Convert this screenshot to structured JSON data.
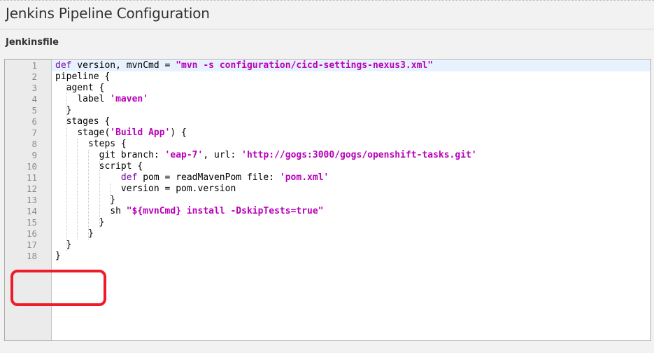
{
  "page": {
    "title": "Jenkins Pipeline Configuration",
    "section_label": "Jenkinsfile"
  },
  "editor": {
    "language": "groovy",
    "active_line": 1,
    "highlighted_lines": [
      17,
      18
    ],
    "highlight_color": "#ee1c2a",
    "keyword_color": "#7a0aa8",
    "string_color": "#b800b8",
    "lines": [
      {
        "n": "1",
        "indent": 0,
        "tokens": [
          {
            "t": "def",
            "k": "kw"
          },
          {
            "t": " version, mvnCmd = "
          },
          {
            "t": "\"mvn -s configuration/cicd-settings-nexus3.xml\"",
            "k": "str"
          }
        ]
      },
      {
        "n": "2",
        "indent": 0,
        "tokens": [
          {
            "t": "pipeline {"
          }
        ]
      },
      {
        "n": "3",
        "indent": 2,
        "tokens": [
          {
            "t": "agent {"
          }
        ]
      },
      {
        "n": "4",
        "indent": 4,
        "tokens": [
          {
            "t": "label "
          },
          {
            "t": "'maven'",
            "k": "str"
          }
        ]
      },
      {
        "n": "5",
        "indent": 2,
        "tokens": [
          {
            "t": "}"
          }
        ]
      },
      {
        "n": "6",
        "indent": 2,
        "tokens": [
          {
            "t": "stages {"
          }
        ]
      },
      {
        "n": "7",
        "indent": 4,
        "tokens": [
          {
            "t": "stage("
          },
          {
            "t": "'Build App'",
            "k": "str"
          },
          {
            "t": ") {"
          }
        ]
      },
      {
        "n": "8",
        "indent": 6,
        "tokens": [
          {
            "t": "steps {"
          }
        ]
      },
      {
        "n": "9",
        "indent": 8,
        "tokens": [
          {
            "t": "git branch: "
          },
          {
            "t": "'eap-7'",
            "k": "str"
          },
          {
            "t": ", url: "
          },
          {
            "t": "'http://gogs:3000/gogs/openshift-tasks.git'",
            "k": "str"
          }
        ]
      },
      {
        "n": "10",
        "indent": 8,
        "tokens": [
          {
            "t": "script {"
          }
        ]
      },
      {
        "n": "11",
        "indent": 12,
        "tokens": [
          {
            "t": "def",
            "k": "kw"
          },
          {
            "t": " pom = readMavenPom file: "
          },
          {
            "t": "'pom.xml'",
            "k": "str"
          }
        ]
      },
      {
        "n": "12",
        "indent": 12,
        "tokens": [
          {
            "t": "version = pom.version"
          }
        ]
      },
      {
        "n": "13",
        "indent": 10,
        "tokens": [
          {
            "t": "}"
          }
        ]
      },
      {
        "n": "14",
        "indent": 10,
        "tokens": [
          {
            "t": "sh "
          },
          {
            "t": "\"${mvnCmd} install -DskipTests=true\"",
            "k": "str"
          }
        ]
      },
      {
        "n": "15",
        "indent": 8,
        "tokens": [
          {
            "t": "}"
          }
        ]
      },
      {
        "n": "16",
        "indent": 6,
        "tokens": [
          {
            "t": "}"
          }
        ]
      },
      {
        "n": "17",
        "indent": 2,
        "tokens": [
          {
            "t": "}"
          }
        ]
      },
      {
        "n": "18",
        "indent": 0,
        "tokens": [
          {
            "t": "}"
          }
        ]
      }
    ]
  }
}
